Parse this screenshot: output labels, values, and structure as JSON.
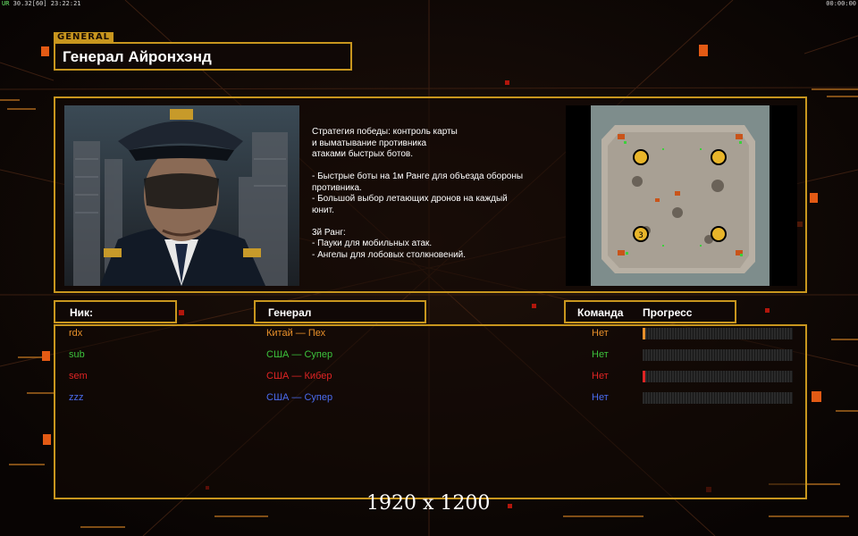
{
  "hud": {
    "left_prefix": "UR",
    "left_text": "30.32[60] 23:22:21",
    "right_text": "00:00:00"
  },
  "header": {
    "tag": "GENERAL",
    "title": "Генерал Айронхэнд"
  },
  "description": "Стратегия победы: контроль карты\nи выматывание противника\nатаками быстрых ботов.\n\n- Быстрые боты на 1м Ранге для объезда обороны\n противника.\n- Большой выбор летающих дронов на каждый\nюнит.\n\n3й Ранг:\n- Пауки для мобильных атак.\n- Ангелы для лобовых столкновений.",
  "map": {
    "marker_label": "3"
  },
  "columns": {
    "nick": "Ник:",
    "general": "Генерал",
    "team": "Команда",
    "progress": "Прогресс"
  },
  "players": [
    {
      "nick": "rdx",
      "general": "Китай — Пех",
      "team": "Нет",
      "color": "#e8902a",
      "progress": 0.01
    },
    {
      "nick": "sub",
      "general": "США — Супер",
      "team": "Нет",
      "color": "#3cc23c",
      "progress": 0.0
    },
    {
      "nick": "sem",
      "general": "США — Кибер",
      "team": "Нет",
      "color": "#e02424",
      "progress": 0.01
    },
    {
      "nick": "zzz",
      "general": "США — Супер",
      "team": "Нет",
      "color": "#4a6cf0",
      "progress": 0.0
    }
  ],
  "resolution_label": "1920 x 1200"
}
